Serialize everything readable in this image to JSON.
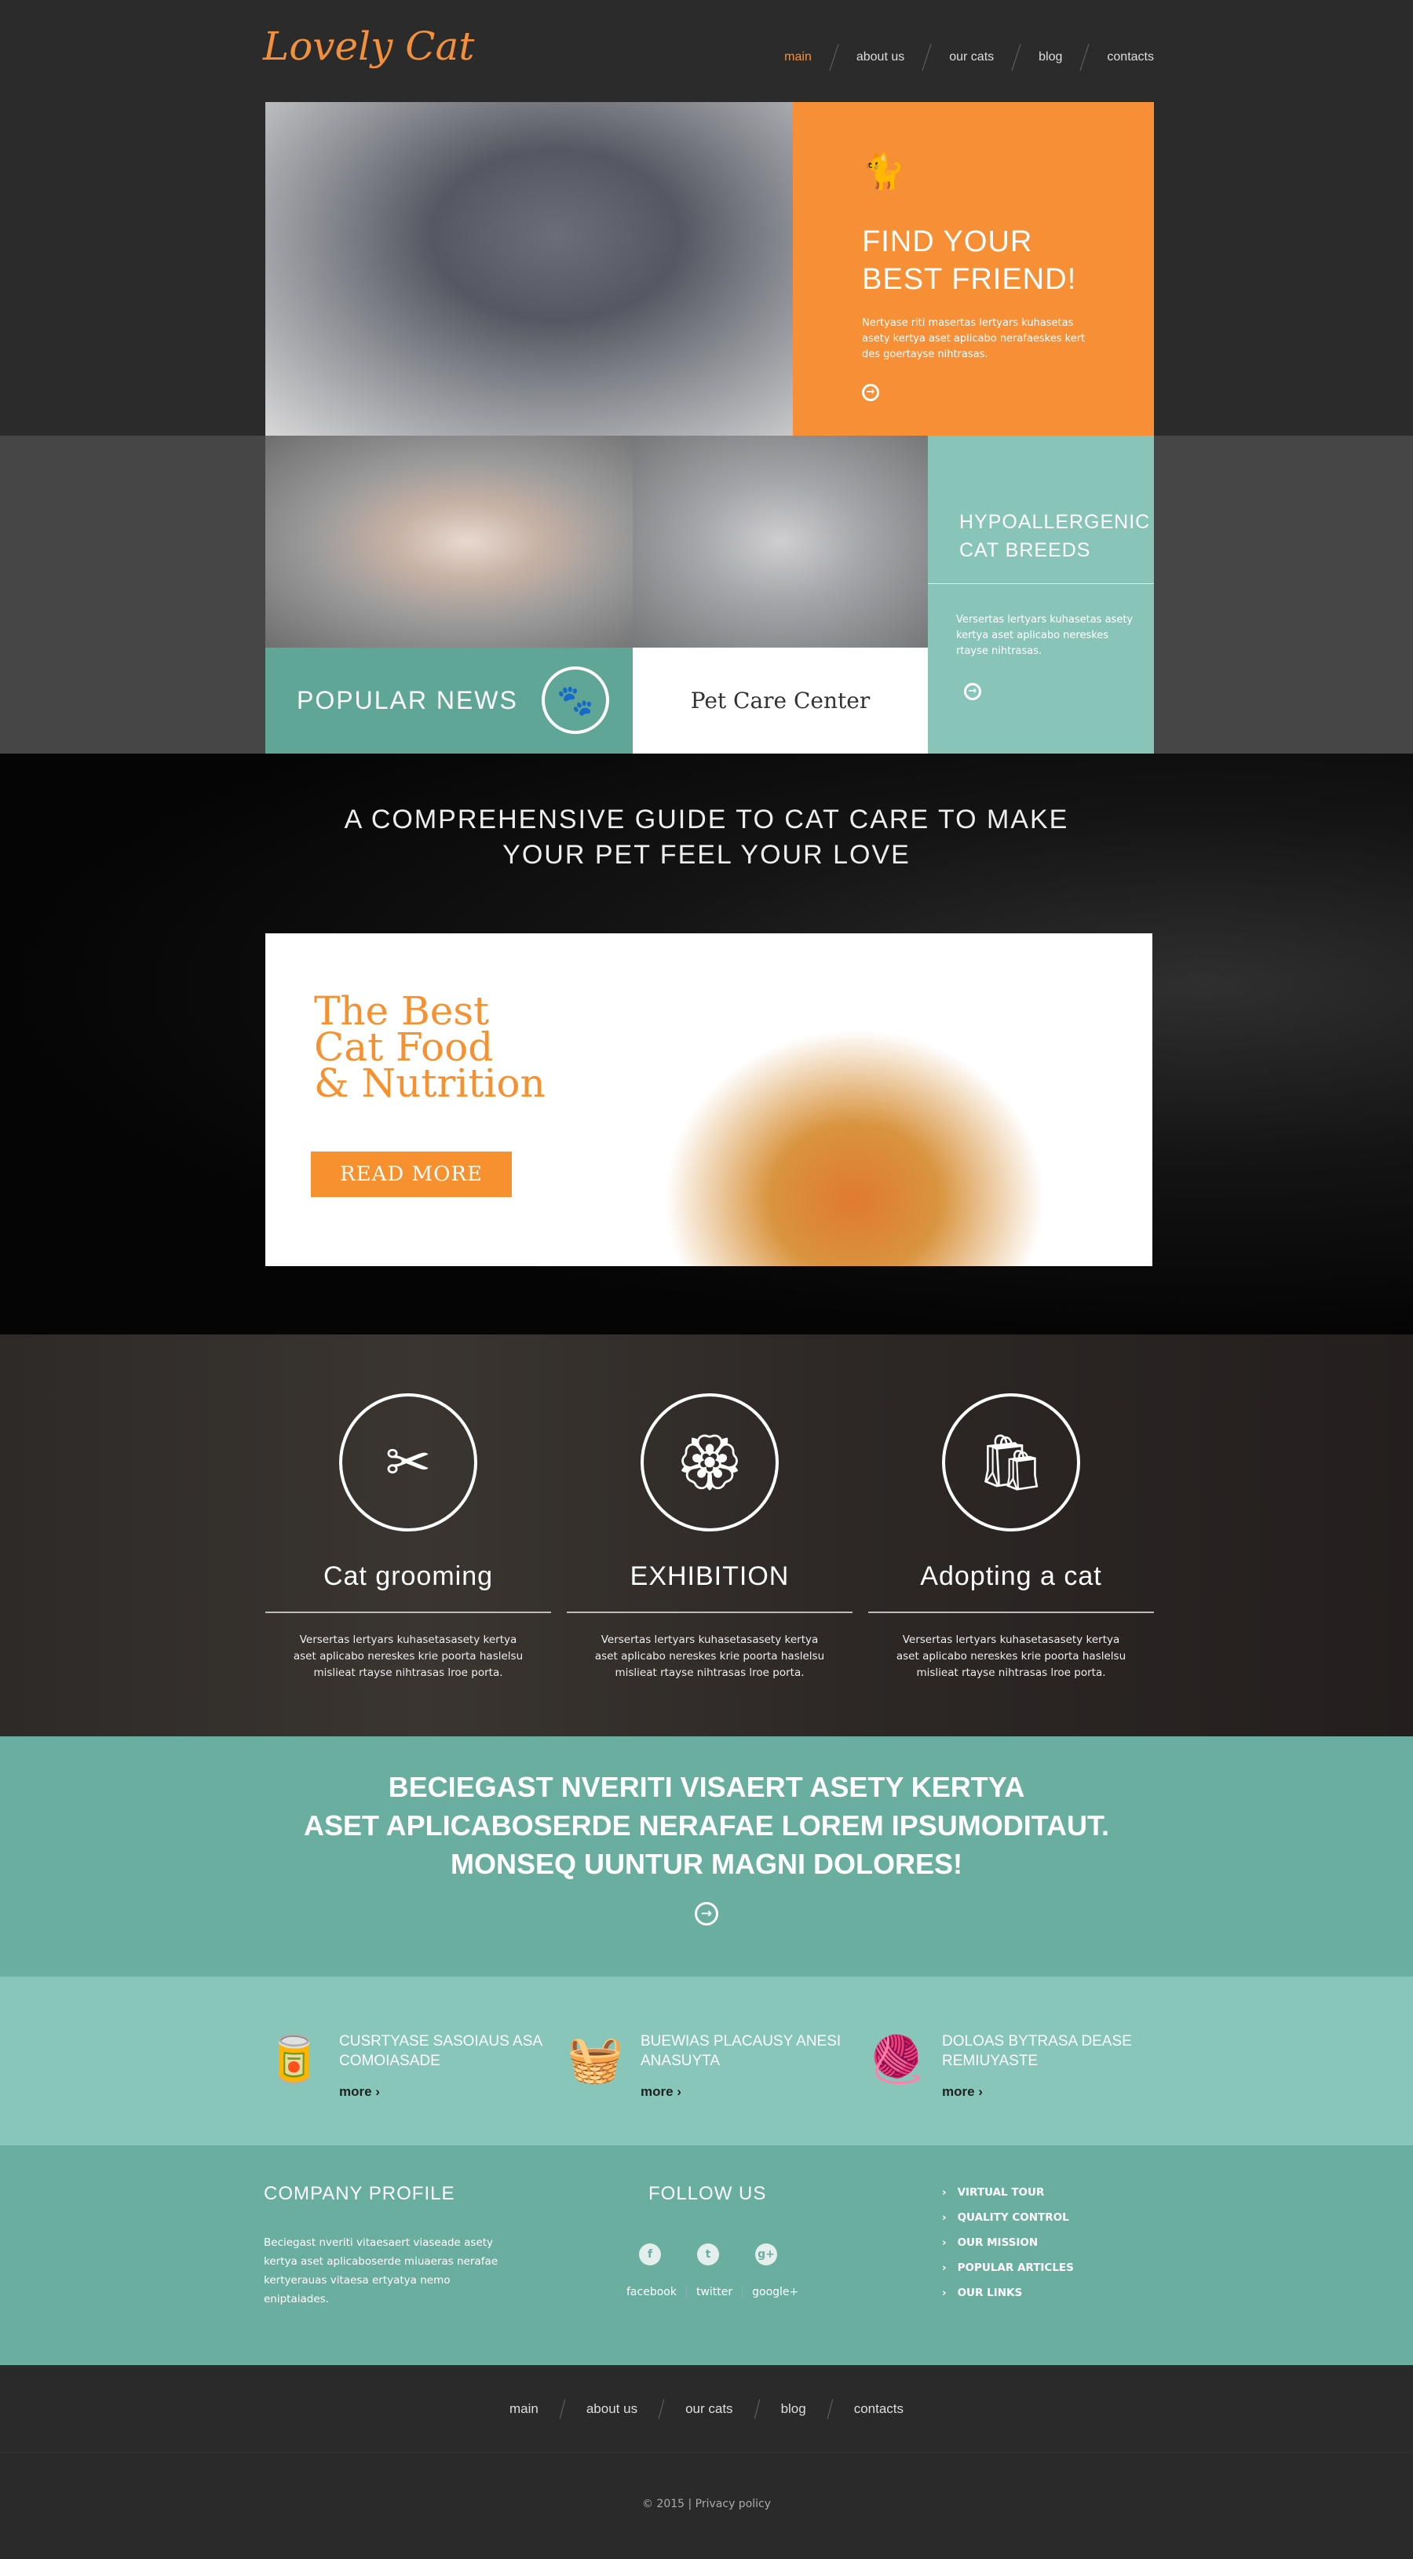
{
  "header": {
    "logo": "Lovely Cat",
    "nav": [
      {
        "label": "main",
        "active": true
      },
      {
        "label": "about us"
      },
      {
        "label": "our cats"
      },
      {
        "label": "blog"
      },
      {
        "label": "contacts"
      }
    ]
  },
  "hero": {
    "icon": "cat-icon",
    "title_line1": "FIND YOUR",
    "title_line2": "BEST FRIEND!",
    "text": "Nertyase riti masertas lertyars kuhasetas asety kertya aset aplicabo nerafaeskes kert des goertayse nihtrasas.",
    "arrow": "→"
  },
  "tiles": {
    "popular_news": "POPULAR NEWS",
    "pet_care": "Pet Care Center",
    "hypo_line1": "HYPOALLERGENIC",
    "hypo_line2": "CAT BREEDS",
    "hypo_text": "Versertas lertyars kuhasetas asety kertya aset aplicabo nereskes rtayse nihtrasas."
  },
  "guide": {
    "line1": "A COMPREHENSIVE GUIDE TO CAT CARE TO MAKE",
    "line2": "YOUR PET FEEL YOUR LOVE"
  },
  "food": {
    "line1": "The Best",
    "line2": "Cat Food",
    "line3": "& Nutrition",
    "button": "READ MORE"
  },
  "services": [
    {
      "title": "Cat grooming",
      "icon": "comb-icon",
      "text": "Versertas lertyars kuhasetasasety kertya aset aplicabo nereskes krie poorta haslelsu mislieat rtayse nihtrasas lroe porta."
    },
    {
      "title": "EXHIBITION",
      "icon": "award-ribbon-icon",
      "text": "Versertas lertyars kuhasetasasety kertya aset aplicabo nereskes krie poorta haslelsu mislieat rtayse nihtrasas lroe porta."
    },
    {
      "title": "Adopting a cat",
      "icon": "food-bag-icon",
      "text": "Versertas lertyars kuhasetasasety kertya aset aplicabo nereskes krie poorta haslelsu mislieat rtayse nihtrasas lroe porta."
    }
  ],
  "banner": {
    "line1": "BECIEGAST NVERITI VISAERT ASETY KERTYA",
    "line2": "ASET APLICABOSERDE NERAFAE LOREM IPSUMODITAUT.",
    "line3": "MONSEQ UUNTUR MAGNI DOLORES!"
  },
  "features": [
    {
      "icon": "cat-food-can-icon",
      "line1": "CUSRTYASE SASOIAUS ASA",
      "line2": "COMOIASADE",
      "more": "more"
    },
    {
      "icon": "pet-carrier-icon",
      "line1": "BUEWIAS PLACAUSY ANESI",
      "line2": "ANASUYTA",
      "more": "more"
    },
    {
      "icon": "yarn-ball-icon",
      "line1": "DOLOAS BYTRASA DEASE",
      "line2": "REMIUYASTE",
      "more": "more"
    }
  ],
  "footer": {
    "company_title": "COMPANY PROFILE",
    "company_text": "Beciegast nveriti vitaesaert viaseade asety kertya aset aplicaboserde miuaeras nerafae kertyerauas vitaesa ertyatya nemo eniptaiades.",
    "follow_title": "FOLLOW US",
    "social": [
      "facebook",
      "twitter",
      "google+"
    ],
    "links": [
      "VIRTUAL TOUR",
      "QUALITY CONTROL",
      "OUR MISSION",
      "POPULAR ARTICLES",
      "OUR LINKS"
    ]
  },
  "bottom_nav": [
    "main",
    "about us",
    "our cats",
    "blog",
    "contacts"
  ],
  "copyright": "© 2015 | Privacy policy",
  "colors": {
    "orange": "#f78f37",
    "teal": "#6aae9f",
    "mint": "#88c6b9",
    "dark": "#2a2a2a"
  }
}
